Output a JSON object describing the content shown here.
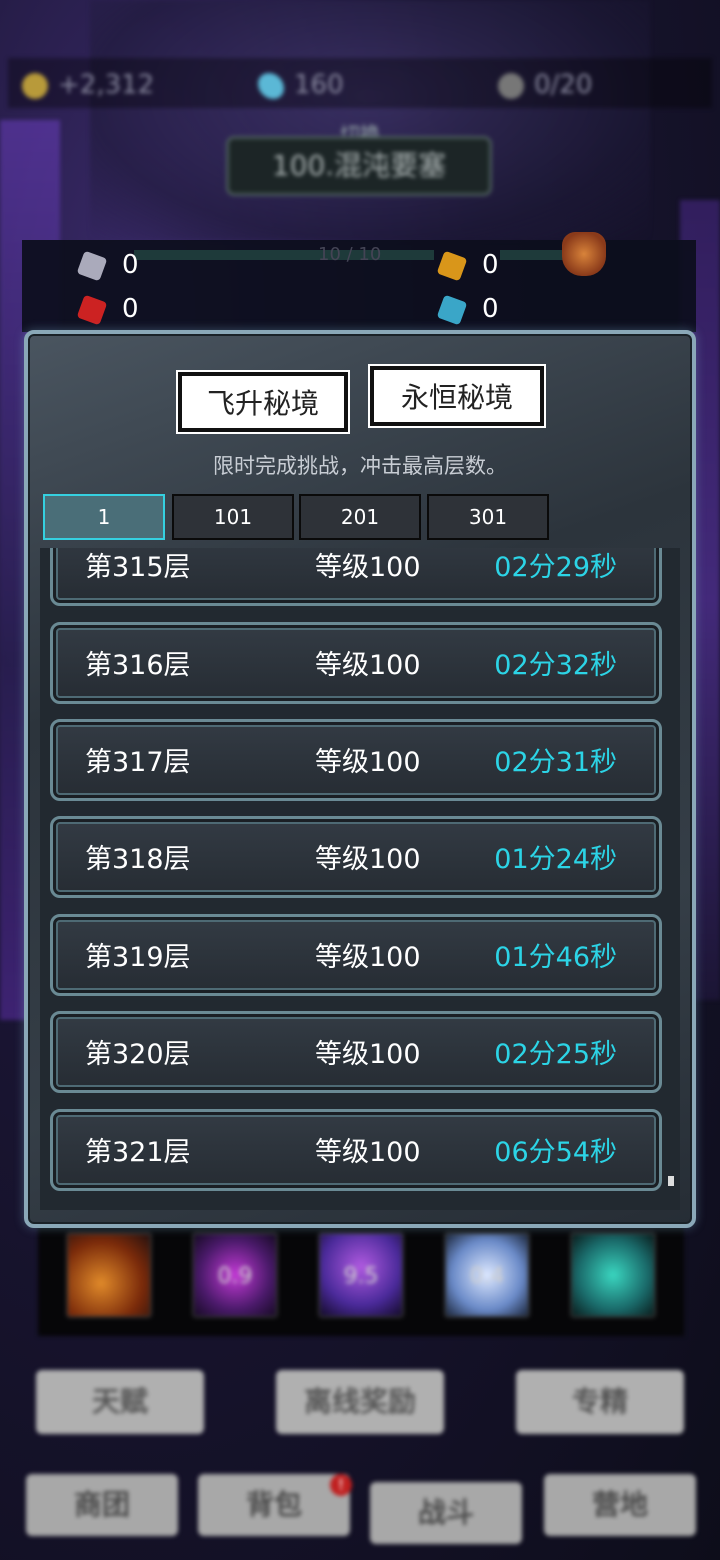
{
  "resources": {
    "gold": "+2,312",
    "gems": "160",
    "slots": "0/20"
  },
  "switch": {
    "label": "切换",
    "location": "100.混沌要塞"
  },
  "stats": {
    "silver_stone": "0",
    "red_stone": "0",
    "gold_stone": "0",
    "blue_stone": "0",
    "progress": "10 / 10"
  },
  "modal": {
    "mode_tabs": [
      "飞升秘境",
      "永恒秘境"
    ],
    "subtitle": "限时完成挑战，冲击最高层数。",
    "range_tabs": [
      "1",
      "101",
      "201",
      "301"
    ],
    "selected_range": "1",
    "rows": [
      {
        "floor": "第315层",
        "level": "等级100",
        "time": "02分29秒"
      },
      {
        "floor": "第316层",
        "level": "等级100",
        "time": "02分32秒"
      },
      {
        "floor": "第317层",
        "level": "等级100",
        "time": "02分31秒"
      },
      {
        "floor": "第318层",
        "level": "等级100",
        "time": "01分24秒"
      },
      {
        "floor": "第319层",
        "level": "等级100",
        "time": "01分46秒"
      },
      {
        "floor": "第320层",
        "level": "等级100",
        "time": "02分25秒"
      },
      {
        "floor": "第321层",
        "level": "等级100",
        "time": "06分54秒"
      }
    ]
  },
  "skills": [
    "",
    "0.9",
    "9.5",
    "0.4",
    ""
  ],
  "actions": [
    "天赋",
    "离线奖励",
    "专精"
  ],
  "nav": {
    "items": [
      "商团",
      "背包",
      "战斗",
      "营地"
    ],
    "badge": "!"
  },
  "colors": {
    "time_accent": "#2cd4e6",
    "tab_selected_border": "#35d0e0"
  }
}
